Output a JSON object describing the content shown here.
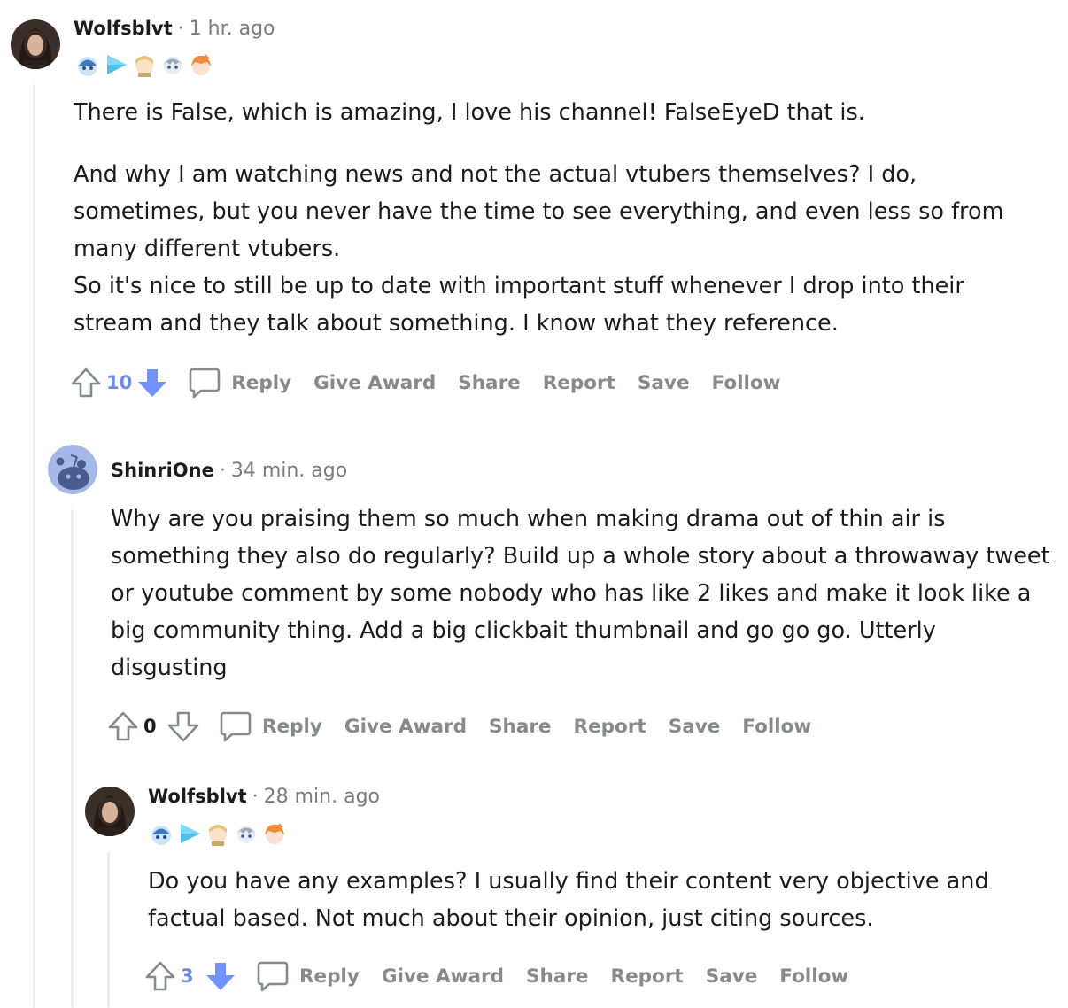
{
  "comments": [
    {
      "author": "Wolfsblvt",
      "separator": "·",
      "time": "1 hr. ago",
      "paragraphs": [
        "There is False, which is amazing, I love his channel! FalseEyeD that is.",
        "And why I am watching news and not the actual vtubers themselves? I do, sometimes, but you never have the time to see everything, and even less so from many different vtubers.",
        "So it's nice to still be up to date with important stuff whenever I drop into their stream and they talk about something. I know what they reference."
      ],
      "score": "10",
      "vote_state": "down",
      "actions": {
        "reply": "Reply",
        "award": "Give Award",
        "share": "Share",
        "report": "Report",
        "save": "Save",
        "follow": "Follow"
      }
    },
    {
      "author": "ShinriOne",
      "separator": "·",
      "time": "34 min. ago",
      "paragraphs": [
        "Why are you praising them so much when making drama out of thin air is something they also do regularly? Build up a whole story about a throwaway tweet or youtube comment by some nobody who has like 2 likes and make it look like a big community thing. Add a big clickbait thumbnail and go go go. Utterly disgusting"
      ],
      "score": "0",
      "vote_state": "none",
      "actions": {
        "reply": "Reply",
        "award": "Give Award",
        "share": "Share",
        "report": "Report",
        "save": "Save",
        "follow": "Follow"
      }
    },
    {
      "author": "Wolfsblvt",
      "separator": "·",
      "time": "28 min. ago",
      "paragraphs": [
        "Do you have any examples? I usually find their content very objective and factual based. Not much about their opinion, just citing sources."
      ],
      "score": "3",
      "vote_state": "down",
      "actions": {
        "reply": "Reply",
        "award": "Give Award",
        "share": "Share",
        "report": "Report",
        "save": "Save",
        "follow": "Follow"
      }
    }
  ],
  "flair_icons": [
    "gura-flair-icon",
    "play-flair-icon",
    "amelia-flair-icon",
    "kanata-flair-icon",
    "kiara-flair-icon"
  ],
  "colors": {
    "upvote_score": "#6a8ce0",
    "downvote_active": "#7193ff",
    "muted_action": "#878a8c",
    "thread_line": "#edeff1",
    "default_avatar_bg": "#a5b8e8"
  }
}
